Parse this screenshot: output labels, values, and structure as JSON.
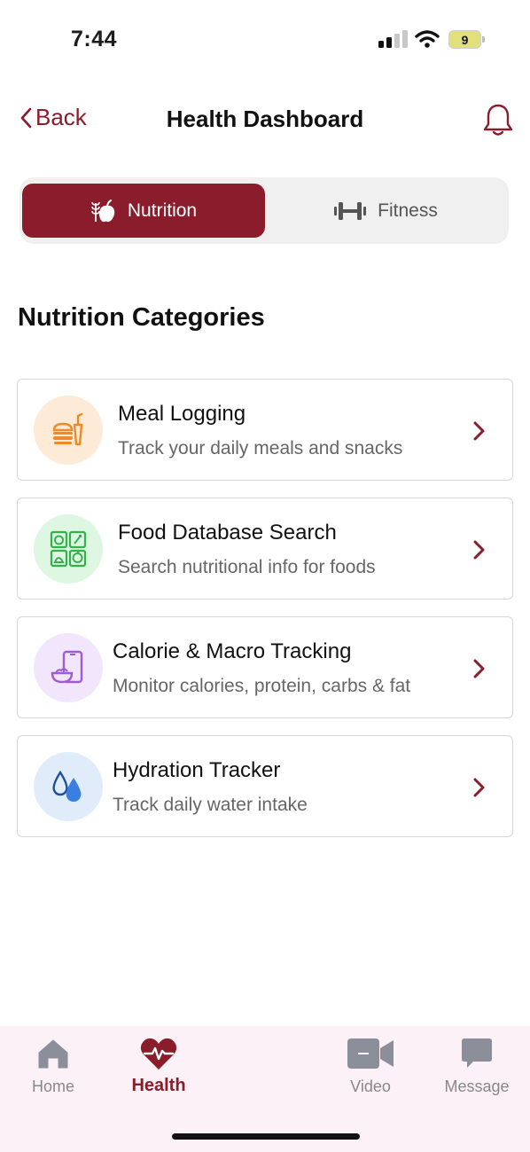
{
  "status": {
    "time": "7:44",
    "battery": "9"
  },
  "header": {
    "back_label": "Back",
    "title": "Health Dashboard"
  },
  "tabs": [
    {
      "label": "Nutrition",
      "icon": "apple-wheat-icon",
      "active": true
    },
    {
      "label": "Fitness",
      "icon": "dumbbell-icon",
      "active": false
    }
  ],
  "section_title": "Nutrition Categories",
  "categories": [
    {
      "title": "Meal Logging",
      "subtitle": "Track your daily meals and snacks",
      "icon": "meal-log-icon",
      "icon_bg": "#fdebd7",
      "icon_color": "#f08a24"
    },
    {
      "title": "Food Database Search",
      "subtitle": "Search nutritional info for foods",
      "icon": "food-database-icon",
      "icon_bg": "#ddf7e3",
      "icon_color": "#35b14a"
    },
    {
      "title": "Calorie & Macro Tracking",
      "subtitle": "Monitor calories, protein, carbs & fat",
      "icon": "phone-bowl-icon",
      "icon_bg": "#f1e6fb",
      "icon_color": "#a15bd6"
    },
    {
      "title": "Hydration Tracker",
      "subtitle": "Track daily water intake",
      "icon": "water-drops-icon",
      "icon_bg": "#e1ecfb",
      "icon_color": "#3a7fe0"
    }
  ],
  "nav": [
    {
      "label": "Home",
      "icon": "home-icon",
      "active": false
    },
    {
      "label": "Health",
      "icon": "heart-pulse-icon",
      "active": true
    },
    {
      "label": "Video",
      "icon": "video-camera-icon",
      "active": false
    },
    {
      "label": "Message",
      "icon": "message-bubble-icon",
      "active": false
    }
  ],
  "colors": {
    "accent": "#8a1c2b",
    "nav_background": "#fbf1f6"
  }
}
